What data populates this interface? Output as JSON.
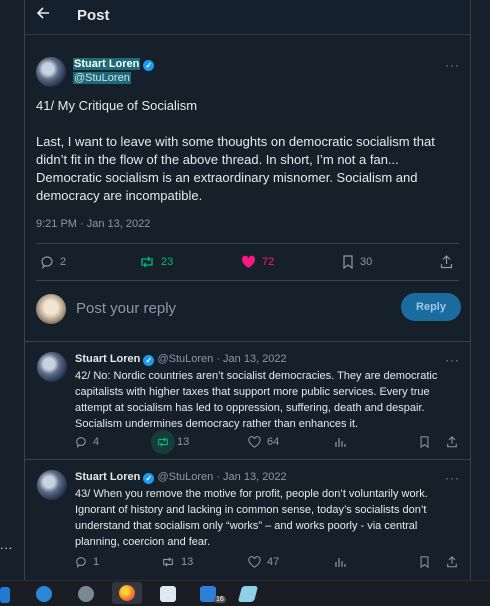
{
  "header": {
    "back_icon": "arrow-left-icon",
    "title": "Post"
  },
  "left_overflow": "...",
  "main_post": {
    "author_name": "Stuart Loren",
    "handle": "@StuLoren",
    "more": "···",
    "title_line": "41/ My Critique of Socialism",
    "paragraph": "Last, I want to leave with some thoughts on democratic socialism that didn’t fit in the flow of the above thread. In short, I’m not a fan... Democratic socialism is an extraordinary misnomer. Socialism and democracy are incompatible.",
    "timestamp": "9:21 PM · Jan 13, 2022",
    "stats": {
      "replies": "2",
      "reposts": "23",
      "likes": "72",
      "bookmarks": "30"
    }
  },
  "reply_composer": {
    "placeholder": "Post your reply",
    "button_label": "Reply"
  },
  "replies": [
    {
      "author_name": "Stuart Loren",
      "meta": "@StuLoren · Jan 13, 2022",
      "more": "···",
      "text": "42/ No: Nordic countries aren’t socialist democracies. They are democratic capitalists with higher taxes that support more public services. Every true attempt at socialism has led to oppression, suffering, death and despair. Socialism undermines democracy rather than enhances it.",
      "replies": "4",
      "reposts": "13",
      "likes": "64"
    },
    {
      "author_name": "Stuart Loren",
      "meta": "@StuLoren · Jan 13, 2022",
      "more": "···",
      "text": "43/ When you remove the motive for profit, people don’t voluntarily work. Ignorant of history and lacking in common sense, today’s socialists don’t understand that socialism only “works” – and works poorly - via central planning, coercion and fear.",
      "replies": "1",
      "reposts": "13",
      "likes": "47"
    }
  ],
  "taskbar": {
    "badge_count": "16"
  },
  "colors": {
    "background": "#15202b",
    "accent": "#1d9bf0",
    "repost": "#00ba7c",
    "like": "#f91880"
  }
}
